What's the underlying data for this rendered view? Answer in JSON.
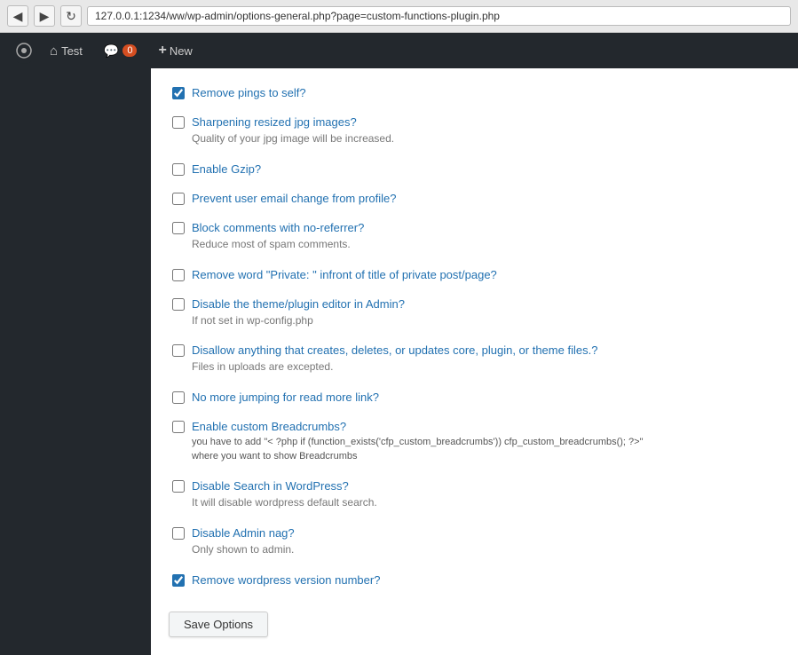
{
  "browser": {
    "url": "127.0.0.1:1234/ww/wp-admin/options-general.php?page=custom-functions-plugin.php",
    "back_icon": "◀",
    "forward_icon": "▶",
    "refresh_icon": "↻"
  },
  "adminbar": {
    "site_name": "Test",
    "comments_count": "0",
    "new_label": "New",
    "wp_icon": "⚙"
  },
  "options": {
    "partial_item": {
      "label": "Remove pings to self?",
      "checked": true
    },
    "items": [
      {
        "id": "sharpening",
        "label": "Sharpening resized jpg images?",
        "description": "Quality of your jpg image will be increased.",
        "checked": false
      },
      {
        "id": "gzip",
        "label": "Enable Gzip?",
        "description": "",
        "checked": false
      },
      {
        "id": "prevent-email",
        "label": "Prevent user email change from profile?",
        "description": "",
        "checked": false
      },
      {
        "id": "block-comments",
        "label": "Block comments with no-referrer?",
        "description": "Reduce most of spam comments.",
        "checked": false
      },
      {
        "id": "remove-private",
        "label": "Remove word \"Private: \" infront of title of private post/page?",
        "description": "",
        "checked": false
      },
      {
        "id": "disable-editor",
        "label": "Disable the theme/plugin editor in Admin?",
        "description": "If not set in wp-config.php",
        "checked": false
      },
      {
        "id": "disallow-files",
        "label": "Disallow anything that creates, deletes, or updates core, plugin, or theme files.?",
        "description": "Files in uploads are excepted.",
        "checked": false
      },
      {
        "id": "no-jumping",
        "label": "No more jumping for read more link?",
        "description": "",
        "checked": false
      },
      {
        "id": "breadcrumbs",
        "label": "Enable custom Breadcrumbs?",
        "description_line1": "you have to add \"< ?php if (function_exists('cfp_custom_breadcrumbs')) cfp_custom_breadcrumbs(); ?>\"",
        "description_line2": "where you want to show Breadcrumbs",
        "checked": false
      },
      {
        "id": "disable-search",
        "label": "Disable Search in WordPress?",
        "description": "It will disable wordpress default search.",
        "checked": false
      },
      {
        "id": "disable-nag",
        "label": "Disable Admin nag?",
        "description": "Only shown to admin.",
        "checked": false
      },
      {
        "id": "remove-version",
        "label": "Remove wordpress version number?",
        "description": "",
        "checked": true
      }
    ],
    "save_button_label": "Save Options"
  }
}
